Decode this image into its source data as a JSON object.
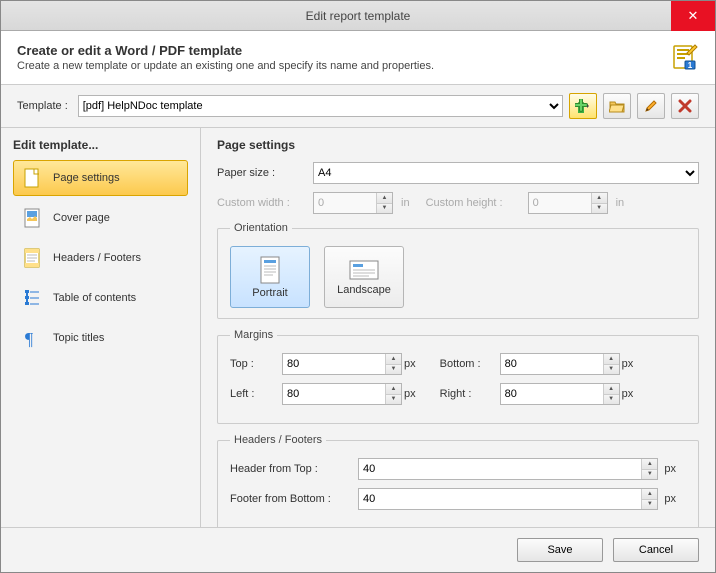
{
  "window": {
    "title": "Edit report template"
  },
  "header": {
    "title": "Create or edit a Word / PDF template",
    "subtitle": "Create a new template or update an existing one and specify its name and properties."
  },
  "template": {
    "label": "Template :",
    "selected": "[pdf] HelpNDoc template"
  },
  "sidebar": {
    "title": "Edit template...",
    "items": [
      {
        "label": "Page settings"
      },
      {
        "label": "Cover page"
      },
      {
        "label": "Headers / Footers"
      },
      {
        "label": "Table of contents"
      },
      {
        "label": "Topic titles"
      }
    ]
  },
  "page": {
    "title": "Page settings",
    "paper_label": "Paper size :",
    "paper_value": "A4",
    "custom_width_label": "Custom width :",
    "custom_width_value": "0",
    "custom_height_label": "Custom height :",
    "custom_height_value": "0",
    "unit_in": "in",
    "unit_px": "px",
    "orientation": {
      "legend": "Orientation",
      "portrait": "Portrait",
      "landscape": "Landscape"
    },
    "margins": {
      "legend": "Margins",
      "top_label": "Top :",
      "top_value": "80",
      "bottom_label": "Bottom :",
      "bottom_value": "80",
      "left_label": "Left :",
      "left_value": "80",
      "right_label": "Right :",
      "right_value": "80"
    },
    "hf": {
      "legend": "Headers / Footers",
      "header_label": "Header from Top :",
      "header_value": "40",
      "footer_label": "Footer from Bottom :",
      "footer_value": "40"
    }
  },
  "footer": {
    "save": "Save",
    "cancel": "Cancel"
  }
}
